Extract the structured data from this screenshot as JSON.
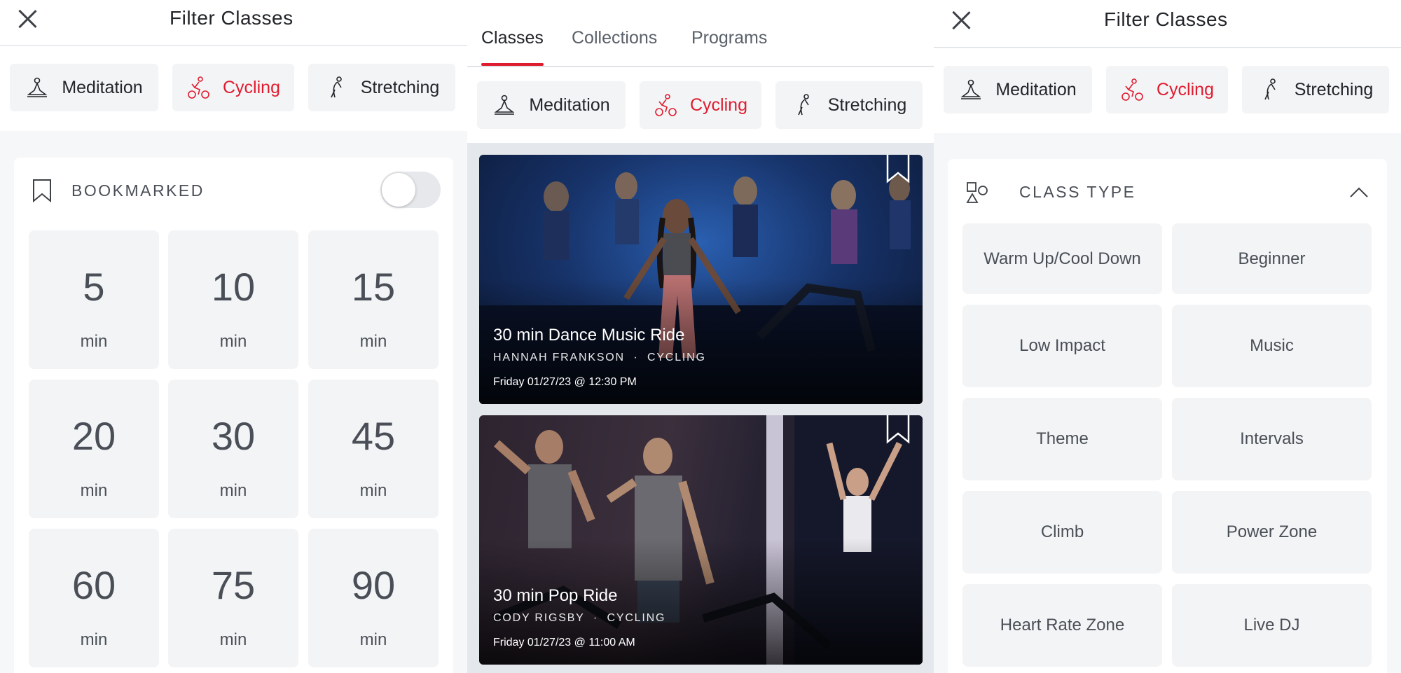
{
  "left_panel": {
    "title": "Filter Classes",
    "chips": [
      {
        "label": "Meditation",
        "icon": "meditation-icon"
      },
      {
        "label": "Cycling",
        "icon": "cycling-icon",
        "active": true
      },
      {
        "label": "Stretching",
        "icon": "stretching-icon"
      }
    ],
    "bookmarked": {
      "label": "BOOKMARKED",
      "toggle_on": false
    },
    "durations": [
      {
        "value": "5",
        "unit": "min"
      },
      {
        "value": "10",
        "unit": "min"
      },
      {
        "value": "15",
        "unit": "min"
      },
      {
        "value": "20",
        "unit": "min"
      },
      {
        "value": "30",
        "unit": "min"
      },
      {
        "value": "45",
        "unit": "min"
      },
      {
        "value": "60",
        "unit": "min"
      },
      {
        "value": "75",
        "unit": "min"
      },
      {
        "value": "90",
        "unit": "min"
      }
    ]
  },
  "middle_panel": {
    "tabs": [
      {
        "label": "Classes",
        "active": true
      },
      {
        "label": "Collections"
      },
      {
        "label": "Programs"
      }
    ],
    "chips": [
      {
        "label": "Meditation",
        "icon": "meditation-icon"
      },
      {
        "label": "Cycling",
        "icon": "cycling-icon",
        "active": true
      },
      {
        "label": "Stretching",
        "icon": "stretching-icon"
      }
    ],
    "classes": [
      {
        "title": "30 min Dance Music Ride",
        "instructor": "HANNAH FRANKSON",
        "separator": "·",
        "discipline": "CYCLING",
        "date": "Friday 01/27/23 @ 12:30 PM"
      },
      {
        "title": "30 min Pop Ride",
        "instructor": "CODY RIGSBY",
        "separator": "·",
        "discipline": "CYCLING",
        "date": "Friday 01/27/23 @ 11:00 AM"
      }
    ]
  },
  "right_panel": {
    "title": "Filter Classes",
    "chips": [
      {
        "label": "Meditation",
        "icon": "meditation-icon"
      },
      {
        "label": "Cycling",
        "icon": "cycling-icon",
        "active": true
      },
      {
        "label": "Stretching",
        "icon": "stretching-icon"
      }
    ],
    "class_type": {
      "label": "CLASS TYPE",
      "options": [
        "Warm Up/Cool Down",
        "Beginner",
        "Low Impact",
        "Music",
        "Theme",
        "Intervals",
        "Climb",
        "Power Zone",
        "Heart Rate Zone",
        "Live DJ"
      ]
    }
  },
  "colors": {
    "accent": "#df1c2f",
    "chip_bg": "#f3f4f6",
    "text": "#222529",
    "muted_text": "#4a4f57"
  }
}
